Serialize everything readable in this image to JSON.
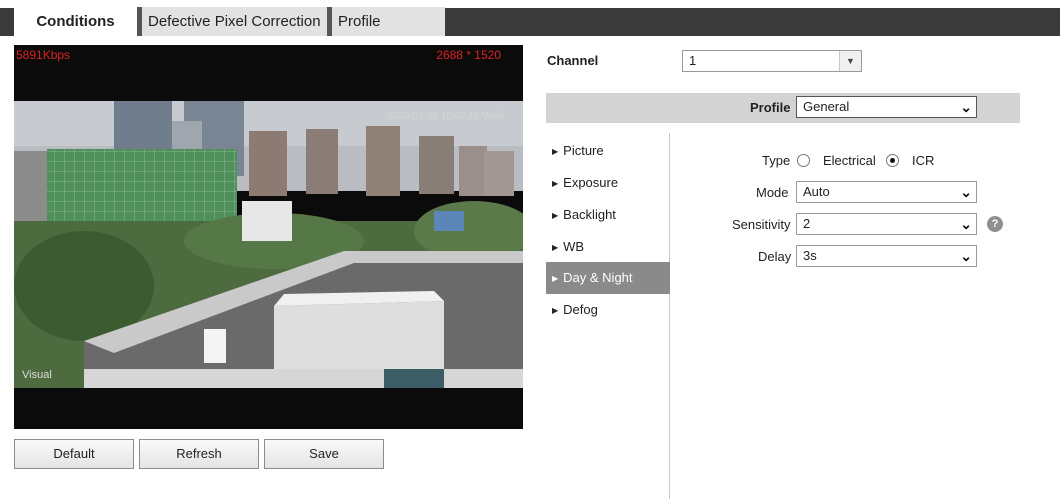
{
  "tabs": [
    {
      "label": "Conditions",
      "active": true
    },
    {
      "label": "Defective Pixel Correction",
      "active": false
    },
    {
      "label": "Profile Management",
      "active": false
    }
  ],
  "video": {
    "bitrate": "5891Kbps",
    "resolution": "2688 * 1520",
    "timestamp": "2020-01-08 10:07:18 Wed",
    "overlay_label": "Visual"
  },
  "buttons": {
    "default": "Default",
    "refresh": "Refresh",
    "save": "Save"
  },
  "channel": {
    "label": "Channel",
    "value": "1"
  },
  "profile": {
    "label": "Profile",
    "value": "General"
  },
  "menu": [
    {
      "label": "Picture",
      "active": false
    },
    {
      "label": "Exposure",
      "active": false
    },
    {
      "label": "Backlight",
      "active": false
    },
    {
      "label": "WB",
      "active": false
    },
    {
      "label": "Day & Night",
      "active": true
    },
    {
      "label": "Defog",
      "active": false
    }
  ],
  "day_night": {
    "type_label": "Type",
    "type_options": [
      "Electrical",
      "ICR"
    ],
    "type_selected": "ICR",
    "mode_label": "Mode",
    "mode_value": "Auto",
    "sensitivity_label": "Sensitivity",
    "sensitivity_value": "2",
    "delay_label": "Delay",
    "delay_value": "3s",
    "help_symbol": "?"
  },
  "colors": {
    "tab_bar": "#3b3b3b",
    "alert_text": "#dd2222",
    "menu_active": "#8a8a8a",
    "profile_bar": "#d3d3d3"
  }
}
